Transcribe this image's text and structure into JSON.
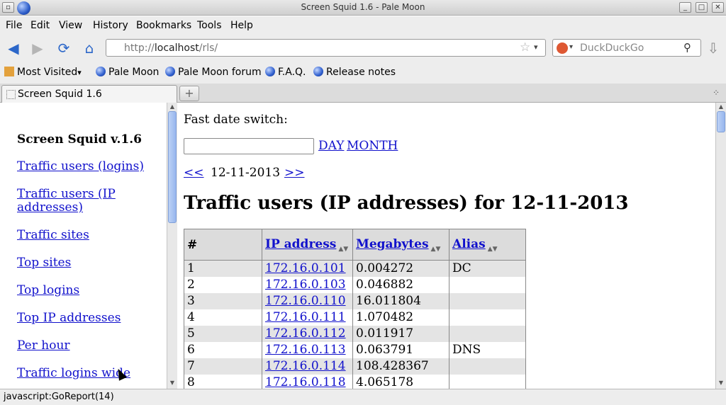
{
  "window": {
    "title": "Screen Squid 1.6 - Pale Moon"
  },
  "menu": [
    "File",
    "Edit",
    "View",
    "History",
    "Bookmarks",
    "Tools",
    "Help"
  ],
  "nav": {
    "url_prefix": "http://",
    "url_host": "localhost",
    "url_path": "/rls/",
    "search_placeholder": "DuckDuckGo"
  },
  "bookmarks": [
    "Most Visited",
    "Pale Moon",
    "Pale Moon forum",
    "F.A.Q.",
    "Release notes"
  ],
  "tab": {
    "label": "Screen Squid 1.6"
  },
  "sidebar": {
    "heading": "Screen Squid v.1.6",
    "links": [
      "Traffic users (logins)",
      "Traffic users (IP addresses)",
      "Traffic sites",
      "Top sites",
      "Top logins",
      "Top IP addresses",
      "Per hour",
      "Traffic logins wide"
    ]
  },
  "main": {
    "fast_date_label": "Fast date switch:",
    "day_link": "DAY",
    "month_link": "MONTH",
    "prev_link": "<<",
    "next_link": ">>",
    "current_date": "12-11-2013",
    "page_title": "Traffic users (IP addresses) for 12-11-2013",
    "table": {
      "headers": [
        "#",
        "IP address",
        "Megabytes",
        "Alias"
      ],
      "rows": [
        [
          "1",
          "172.16.0.101",
          "0.004272",
          "DC"
        ],
        [
          "2",
          "172.16.0.103",
          "0.046882",
          ""
        ],
        [
          "3",
          "172.16.0.110",
          "16.011804",
          ""
        ],
        [
          "4",
          "172.16.0.111",
          "1.070482",
          ""
        ],
        [
          "5",
          "172.16.0.112",
          "0.011917",
          ""
        ],
        [
          "6",
          "172.16.0.113",
          "0.063791",
          "DNS"
        ],
        [
          "7",
          "172.16.0.114",
          "108.428367",
          ""
        ],
        [
          "8",
          "172.16.0.118",
          "4.065178",
          ""
        ]
      ]
    }
  },
  "status": {
    "text": "javascript:GoReport(14)"
  }
}
